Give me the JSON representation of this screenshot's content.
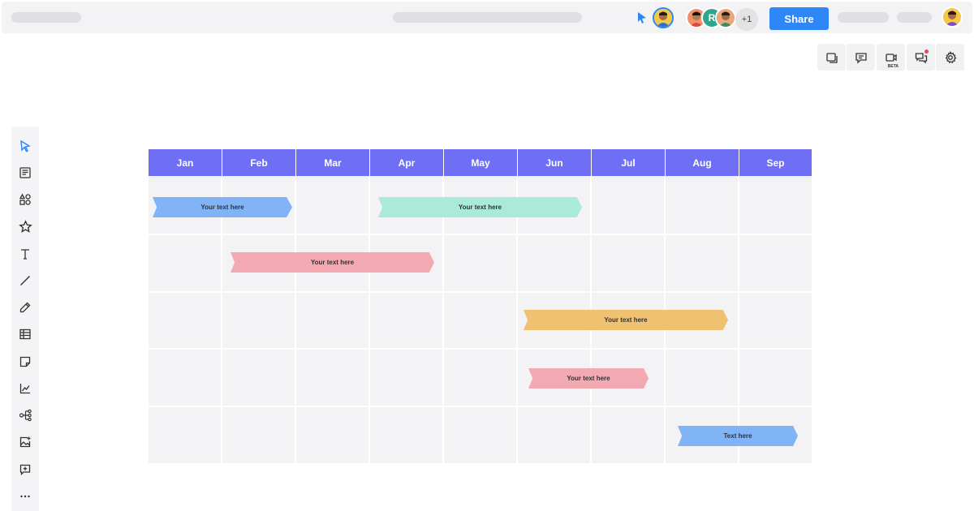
{
  "header": {
    "share_label": "Share",
    "extra_collaborators": "+1",
    "collaborator_initial": "R"
  },
  "right_tools": {
    "beta_label": "BETA"
  },
  "gantt": {
    "months": [
      "Jan",
      "Feb",
      "Mar",
      "Apr",
      "May",
      "Jun",
      "Jul",
      "Aug",
      "Sep"
    ],
    "bars": [
      {
        "label": "Your text here",
        "color": "#80b4f6"
      },
      {
        "label": "Your text here",
        "color": "#a9eadb"
      },
      {
        "label": "Your text here",
        "color": "#f3a9b2"
      },
      {
        "label": "Your text here",
        "color": "#f1c172"
      },
      {
        "label": "Your text here",
        "color": "#f3a9b2"
      },
      {
        "label": "Text here",
        "color": "#80b4f6"
      }
    ]
  },
  "colors": {
    "accent": "#2f86f6",
    "month_header": "#6e6ff5"
  }
}
